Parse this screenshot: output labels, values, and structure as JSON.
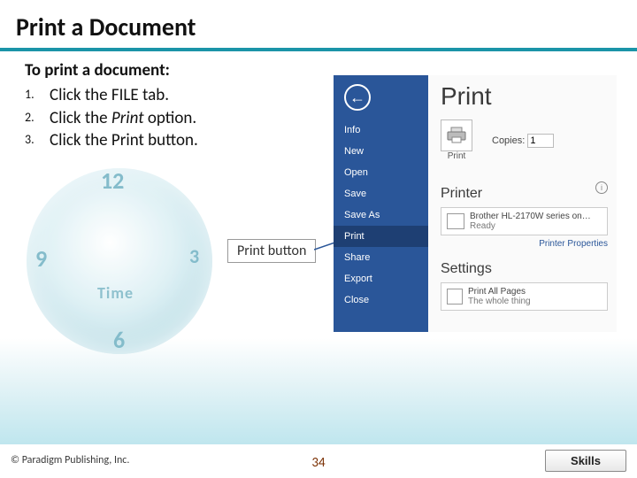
{
  "title": "Print a Document",
  "lead": "To print a document:",
  "steps": [
    {
      "num": "1.",
      "text": "Click the FILE tab."
    },
    {
      "num": "2.",
      "text_before": "Click the ",
      "text_em": "Print",
      "text_after": " option."
    },
    {
      "num": "3.",
      "text": "Click the Print button."
    }
  ],
  "callout": "Print button",
  "clock": {
    "n12": "12",
    "n3": "3",
    "n6": "6",
    "n9": "9",
    "label": "Time"
  },
  "shot": {
    "back": "←",
    "nav": [
      "Info",
      "New",
      "Open",
      "Save",
      "Save As",
      "Print",
      "Share",
      "Export",
      "Close"
    ],
    "heading": "Print",
    "print_label": "Print",
    "copies_label": "Copies:",
    "copies_value": "1",
    "printer_h": "Printer",
    "info": "i",
    "device_name": "Brother HL-2170W series on…",
    "device_status": "Ready",
    "printer_props": "Printer Properties",
    "settings_h": "Settings",
    "setting1_title": "Print All Pages",
    "setting1_sub": "The whole thing"
  },
  "footer": {
    "copyright": "© Paradigm Publishing, Inc.",
    "page": "34",
    "skills": "Skills"
  }
}
